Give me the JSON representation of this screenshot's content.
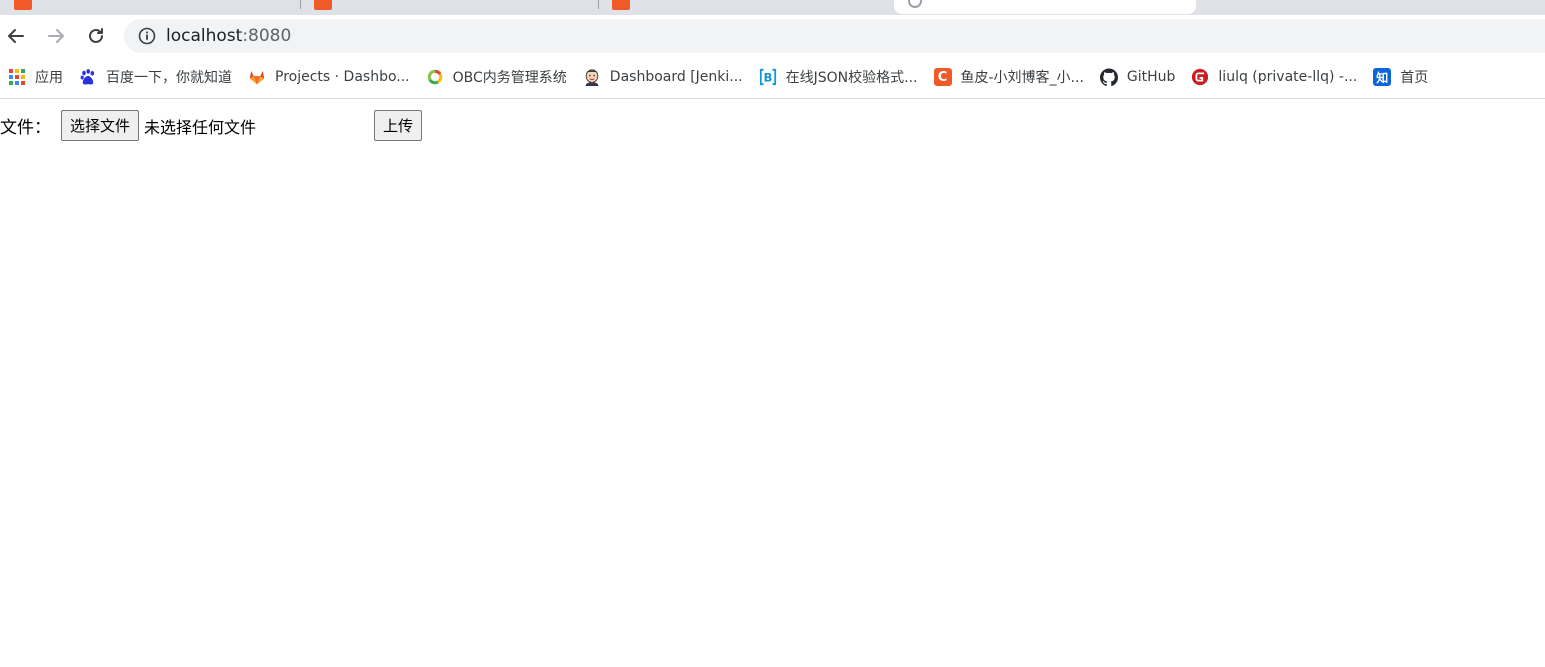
{
  "address_bar": {
    "host": "localhost",
    "port": ":8080"
  },
  "bookmarks": [
    {
      "label": "应用",
      "icon": "apps-grid-icon"
    },
    {
      "label": "百度一下，你就知道",
      "icon": "baidu-paw-icon"
    },
    {
      "label": "Projects · Dashbo...",
      "icon": "gitlab-fox-icon"
    },
    {
      "label": "OBC内务管理系统",
      "icon": "obc-ring-icon"
    },
    {
      "label": "Dashboard [Jenki...",
      "icon": "jenkins-butler-icon"
    },
    {
      "label": "在线JSON校验格式...",
      "icon": "json-bracket-icon",
      "glyph": "B"
    },
    {
      "label": "鱼皮-小刘博客_小...",
      "icon": "csdn-c-icon",
      "glyph": "C"
    },
    {
      "label": "GitHub",
      "icon": "github-octocat-icon"
    },
    {
      "label": "liulq (private-llq) -...",
      "icon": "gitee-g-icon"
    },
    {
      "label": "首页",
      "icon": "zhihu-icon",
      "glyph": "知"
    }
  ],
  "form": {
    "file_label": "文件：",
    "choose_button": "选择文件",
    "no_file_text": "未选择任何文件",
    "upload_button": "上传"
  },
  "colors": {
    "tabstrip": "#dee1e6",
    "omnibox": "#f1f3f4",
    "gitlab": "#e24329",
    "csdn": "#f05a28",
    "json": "#1296db",
    "zhihu": "#0a66d9",
    "gitee": "#c71d23"
  }
}
